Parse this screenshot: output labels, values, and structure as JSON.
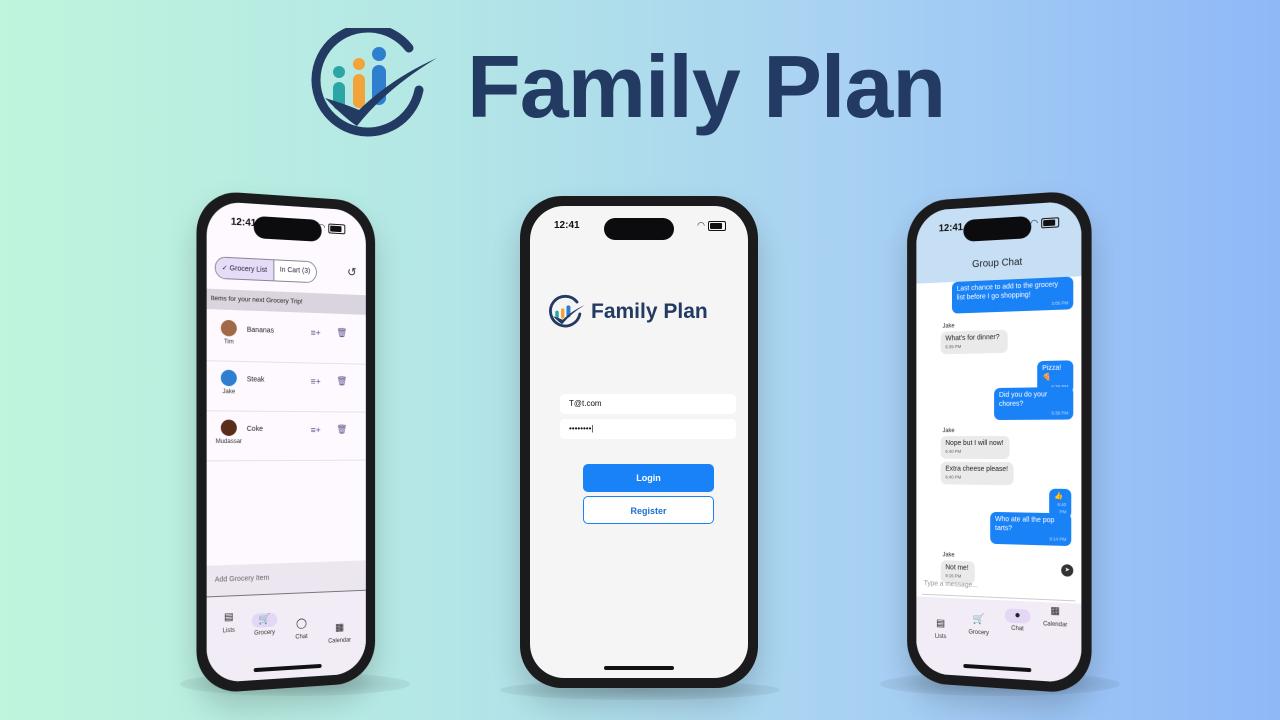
{
  "brand": {
    "name": "Family Plan",
    "colors": {
      "navy": "#233b63",
      "teal": "#2aa6a4",
      "orange": "#f2a33a",
      "blue": "#2f7fd0"
    }
  },
  "status": {
    "time": "12:41"
  },
  "grocery": {
    "segments": [
      {
        "label": "✓ Grocery List",
        "selected": true
      },
      {
        "label": "In Cart (3)",
        "selected": false
      }
    ],
    "history_icon": "history-icon",
    "banner": "Items for your next Grocery Trip!",
    "items": [
      {
        "who": "Tim",
        "item": "Bananas",
        "avatar_color": "#a06a48"
      },
      {
        "who": "Jake",
        "item": "Steak",
        "avatar_color": "#2f7fd0"
      },
      {
        "who": "Mudassar",
        "item": "Coke",
        "avatar_color": "#5a2d1a"
      }
    ],
    "add_placeholder": "Add Grocery Item",
    "nav": [
      {
        "label": "Lists",
        "icon": "clipboard-icon",
        "active": false
      },
      {
        "label": "Grocery",
        "icon": "cart-icon",
        "active": true
      },
      {
        "label": "Chat",
        "icon": "chat-icon",
        "active": false
      },
      {
        "label": "Calendar",
        "icon": "calendar-icon",
        "active": false
      }
    ]
  },
  "login": {
    "logo_text": "Family Plan",
    "email": "T@t.com",
    "password": "••••••••|",
    "login_label": "Login",
    "register_label": "Register"
  },
  "chat": {
    "title": "Group Chat",
    "messages": [
      {
        "from": "me",
        "text": "Last chance to add to the grocery list before I go shopping!",
        "time": "3:05 PM"
      },
      {
        "from": "Jake",
        "text": "What's for dinner?",
        "time": "6:39 PM"
      },
      {
        "from": "me",
        "text": "Pizza! 🍕",
        "time": "6:39 PM"
      },
      {
        "from": "me",
        "text": "Did you do your chores?",
        "time": "6:39 PM"
      },
      {
        "from": "Jake",
        "text": "Nope but I will now!",
        "time": "6:40 PM"
      },
      {
        "from": "Jake",
        "text": "Extra cheese please!",
        "time": "6:40 PM"
      },
      {
        "from": "me",
        "text": "👍",
        "time": "6:40 PM"
      },
      {
        "from": "me",
        "text": "Who ate all the pop tarts?",
        "time": "9:14 PM"
      },
      {
        "from": "Jake",
        "text": "Not me!",
        "time": "9:15 PM"
      }
    ],
    "input_placeholder": "Type a message...",
    "nav": [
      {
        "label": "Lists",
        "icon": "clipboard-icon",
        "active": false
      },
      {
        "label": "Grocery",
        "icon": "cart-icon",
        "active": false
      },
      {
        "label": "Chat",
        "icon": "chat-icon",
        "active": true
      },
      {
        "label": "Calendar",
        "icon": "calendar-icon",
        "active": false
      }
    ]
  }
}
